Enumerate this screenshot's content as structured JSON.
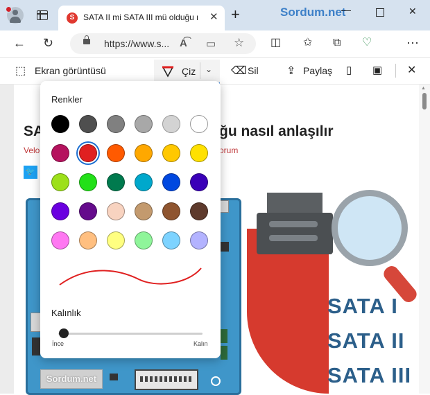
{
  "browser": {
    "tab_title": "SATA II mi SATA III mü olduğu nasıl anlaşılır",
    "window_title_overlay": "Sordum.net",
    "url": "https://www.s...",
    "accent_color": "#1c6fd1"
  },
  "screenshot_toolbar": {
    "capture_label": "Ekran görüntüsü",
    "draw_label": "Çiz",
    "erase_label": "Sil",
    "share_label": "Paylaş"
  },
  "draw_panel": {
    "colors_heading": "Renkler",
    "selected_color": "#e02020",
    "colors": [
      "#000000",
      "#4f4f4f",
      "#808080",
      "#a8a8a8",
      "#d3d3d3",
      "#ffffff",
      "#b5125e",
      "#e02020",
      "#ff5a00",
      "#ffa800",
      "#ffc800",
      "#ffe100",
      "#9de01a",
      "#22e018",
      "#007a4e",
      "#00a8cc",
      "#0048e0",
      "#3a00b8",
      "#6a00e0",
      "#650b8c",
      "#f8d3c0",
      "#c39a6e",
      "#8f5530",
      "#5e3a2c",
      "#ff78f2",
      "#ffbf80",
      "#ffff80",
      "#8ff59a",
      "#7dd3ff",
      "#b3b3ff"
    ],
    "thickness_heading": "Kalınlık",
    "thickness_min_label": "İnce",
    "thickness_max_label": "Kalın",
    "thickness_value": 0.0
  },
  "article": {
    "headline_fragment_left": "SA",
    "headline_fragment_right": "ğu nasıl anlaşılır",
    "byline_left": "Velo",
    "byline_right": "orum",
    "watermark": "Sordum.net"
  },
  "image_labels": [
    "SATA I",
    "SATA II",
    "SATA III"
  ]
}
